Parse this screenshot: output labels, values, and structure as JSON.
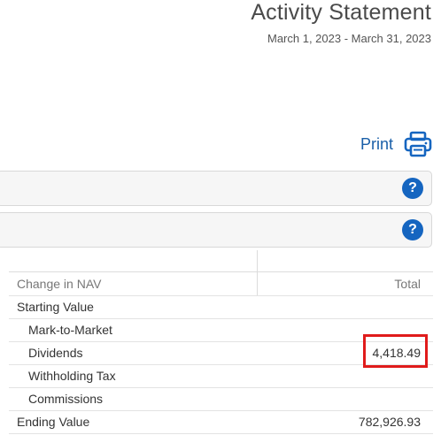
{
  "header": {
    "title": "Activity Statement",
    "date_range": "March 1, 2023 - March 31, 2023"
  },
  "toolbar": {
    "print_label": "Print"
  },
  "sections": [
    {
      "help": "?"
    },
    {
      "help": "?"
    }
  ],
  "nav_table": {
    "header_label": "Change in NAV",
    "header_value": "Total",
    "rows": [
      {
        "label": "Starting Value",
        "value": ""
      },
      {
        "label": "Mark-to-Market",
        "value": ""
      },
      {
        "label": "Dividends",
        "value": "4,418.49"
      },
      {
        "label": "Withholding Tax",
        "value": ""
      },
      {
        "label": "Commissions",
        "value": ""
      },
      {
        "label": "Ending Value",
        "value": "782,926.93"
      }
    ]
  },
  "colors": {
    "accent": "#1565c0",
    "highlight": "#e01b1b"
  }
}
